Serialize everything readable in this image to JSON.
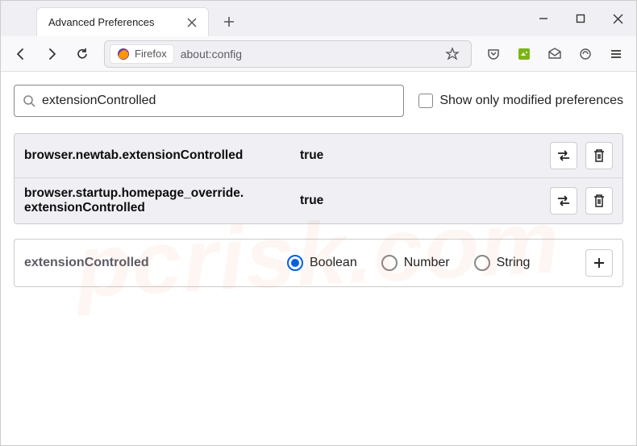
{
  "window": {
    "tab_title": "Advanced Preferences"
  },
  "toolbar": {
    "identity_label": "Firefox",
    "url": "about:config"
  },
  "search": {
    "value": "extensionControlled",
    "show_modified_label": "Show only modified preferences"
  },
  "prefs": [
    {
      "name": "browser.newtab.extensionControlled",
      "value": "true"
    },
    {
      "name": "browser.startup.homepage_override.extensionControlled",
      "value": "true"
    }
  ],
  "new_pref": {
    "name": "extensionControlled",
    "types": [
      "Boolean",
      "Number",
      "String"
    ],
    "selected": 0
  },
  "watermark": "pcrisk.com"
}
